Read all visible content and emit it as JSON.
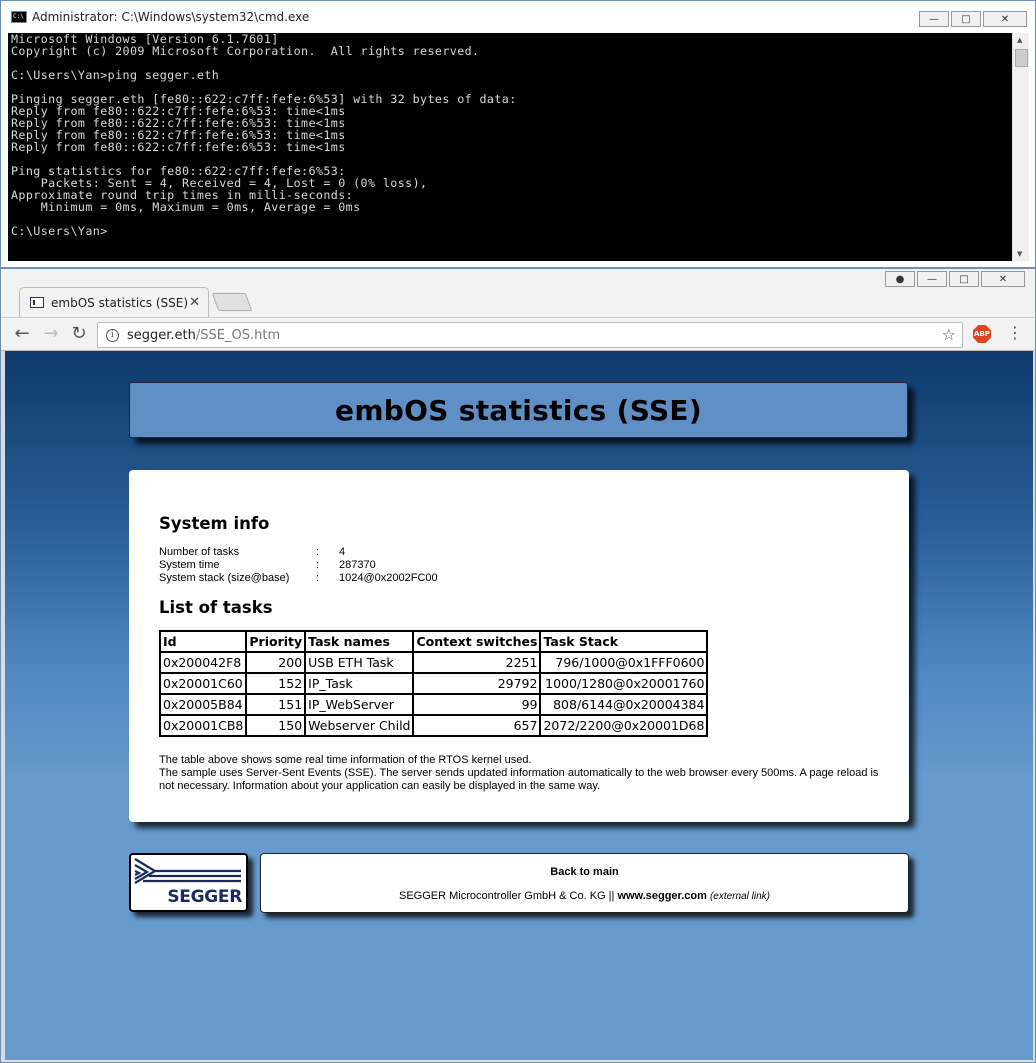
{
  "cmd": {
    "title": "Administrator: C:\\Windows\\system32\\cmd.exe",
    "lines": [
      "Microsoft Windows [Version 6.1.7601]",
      "Copyright (c) 2009 Microsoft Corporation.  All rights reserved.",
      "",
      "C:\\Users\\Yan>ping segger.eth",
      "",
      "Pinging segger.eth [fe80::622:c7ff:fefe:6%53] with 32 bytes of data:",
      "Reply from fe80::622:c7ff:fefe:6%53: time<1ms",
      "Reply from fe80::622:c7ff:fefe:6%53: time<1ms",
      "Reply from fe80::622:c7ff:fefe:6%53: time<1ms",
      "Reply from fe80::622:c7ff:fefe:6%53: time<1ms",
      "",
      "Ping statistics for fe80::622:c7ff:fefe:6%53:",
      "    Packets: Sent = 4, Received = 4, Lost = 0 (0% loss),",
      "Approximate round trip times in milli-seconds:",
      "    Minimum = 0ms, Maximum = 0ms, Average = 0ms",
      "",
      "C:\\Users\\Yan>"
    ]
  },
  "browser": {
    "tab_title": "embOS statistics (SSE)",
    "url_host": "segger.eth",
    "url_path": "/SSE_OS.htm",
    "abp_label": "ABP"
  },
  "page": {
    "heading": "embOS statistics (SSE)",
    "system_info_title": "System info",
    "system_info": [
      {
        "key": "Number of tasks",
        "sep": ":",
        "value": "4"
      },
      {
        "key": "System time",
        "sep": ":",
        "value": "287370"
      },
      {
        "key": "System stack (size@base)",
        "sep": ":",
        "value": "1024@0x2002FC00"
      }
    ],
    "tasks_title": "List of tasks",
    "task_columns": [
      "Id",
      "Priority",
      "Task names",
      "Context switches",
      "Task Stack"
    ],
    "tasks": [
      [
        "0x200042F8",
        "200",
        "USB ETH Task",
        "2251",
        "796/1000@0x1FFF0600"
      ],
      [
        "0x20001C60",
        "152",
        "IP_Task",
        "29792",
        "1000/1280@0x20001760"
      ],
      [
        "0x20005B84",
        "151",
        "IP_WebServer",
        "99",
        "808/6144@0x20004384"
      ],
      [
        "0x20001CB8",
        "150",
        "Webserver Child",
        "657",
        "2072/2200@0x20001D68"
      ]
    ],
    "description_1": "The table above shows some real time information of the RTOS kernel used.",
    "description_2": "The sample uses Server-Sent Events (SSE). The server sends updated information automatically to the web browser every 500ms. A page reload is not necessary. Information about your application can easily be displayed in the same way.",
    "logo_text": "SEGGER",
    "back_link": "Back to main",
    "footer_company": "SEGGER Microcontroller GmbH & Co. KG ||",
    "footer_site": "www.segger.com",
    "footer_external": "(external link)"
  }
}
